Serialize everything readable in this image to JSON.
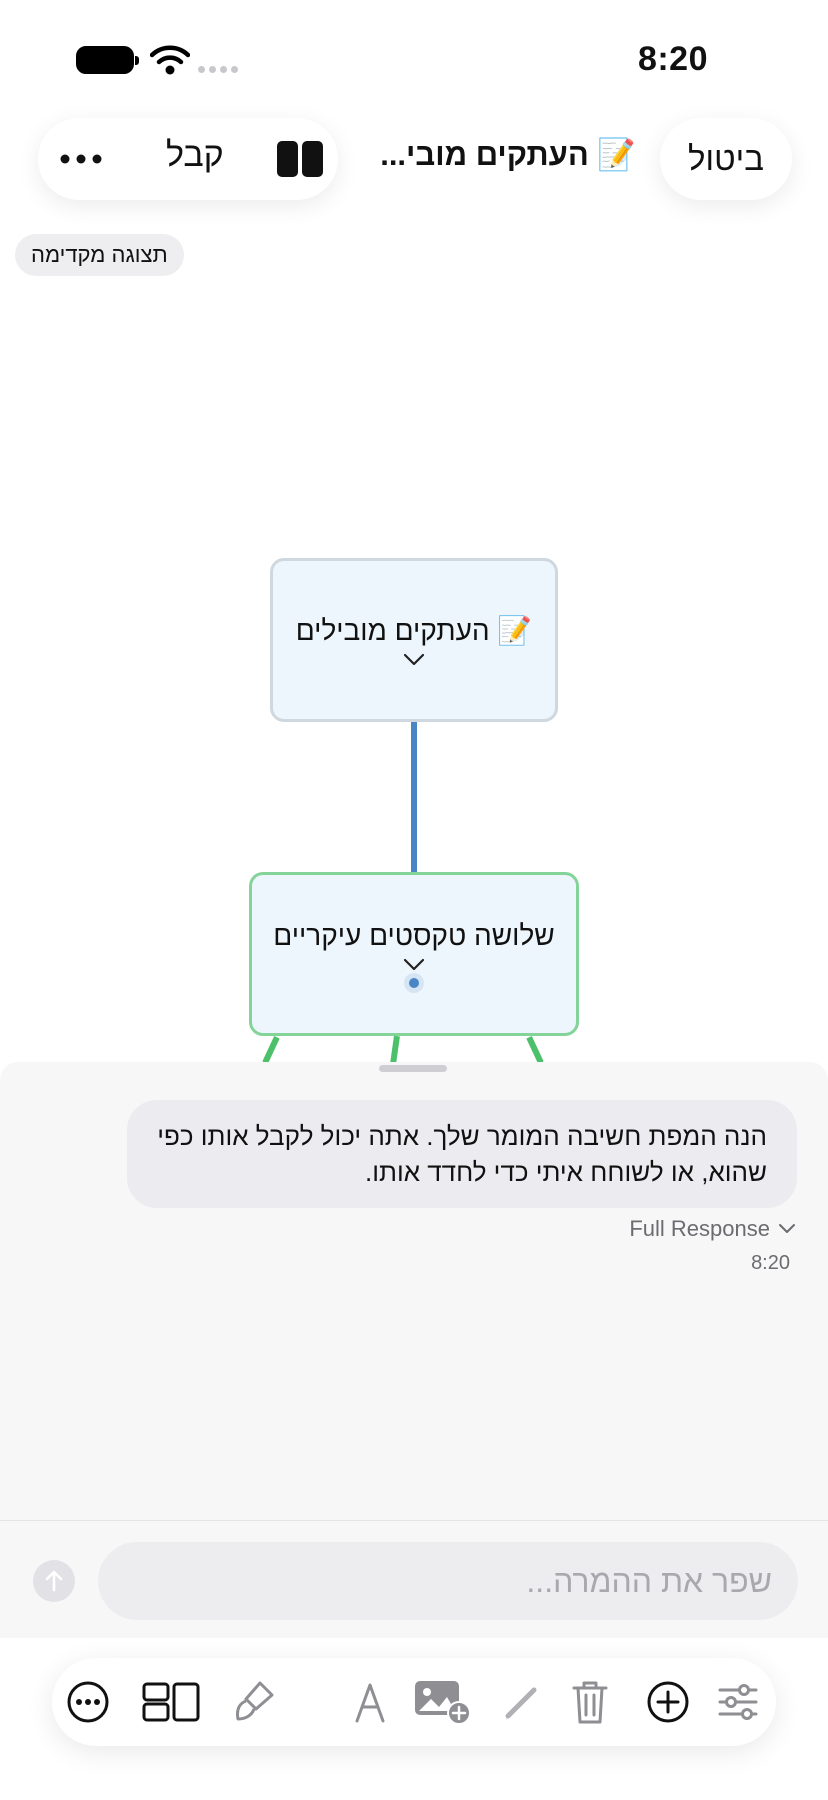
{
  "status_bar": {
    "time": "8:20"
  },
  "header": {
    "accept_label": "קבל",
    "title": "📝 העתקים מובי...",
    "cancel_label": "ביטול"
  },
  "preview_badge": "תצוגה מקדימה",
  "mindmap": {
    "root": {
      "label": "📝 העתקים מובילים"
    },
    "child": {
      "label": "שלושה טקסטים עיקריים"
    },
    "colors": {
      "root_border": "#cfd7df",
      "child_border": "#84d49a",
      "connector": "#4a86c5",
      "branch": "#4cc06a"
    }
  },
  "chat": {
    "message": "הנה המפת חשיבה המומר שלך. אתה יכול לקבל אותו כפי שהוא, או לשוחח איתי כדי לחדד אותו.",
    "full_response_label": "Full Response",
    "timestamp": "8:20",
    "input_placeholder": "שפר את ההמרה..."
  },
  "toolbar": {
    "icons": [
      "more-circle-icon",
      "layout-icon",
      "brush-icon",
      "text-style-icon",
      "add-image-icon",
      "pencil-icon",
      "trash-icon",
      "add-circle-icon",
      "sliders-icon"
    ]
  }
}
